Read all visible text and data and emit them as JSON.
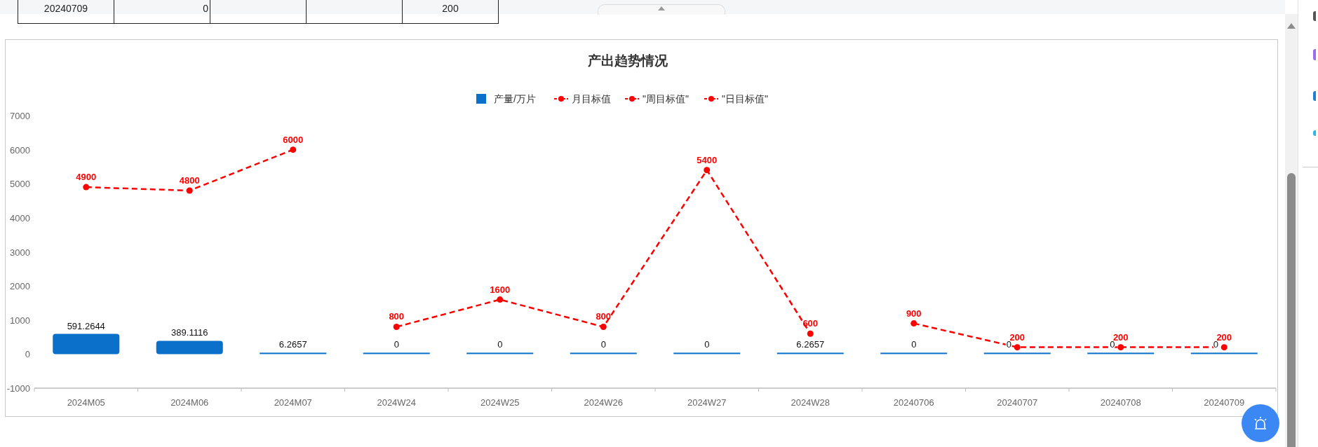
{
  "table_last_row": {
    "column_1": "20240709",
    "column_2": "0",
    "column_5": "200"
  },
  "chart": {
    "title": "产出趋势情况",
    "chart_data": {
      "type": "bar",
      "categories": [
        "2024M05",
        "2024M06",
        "2024M07",
        "2024W24",
        "2024W25",
        "2024W26",
        "2024W27",
        "2024W28",
        "20240706",
        "20240707",
        "20240708",
        "20240709"
      ],
      "ylim": [
        -1000,
        7000
      ],
      "yticks": [
        -1000,
        0,
        1000,
        2000,
        3000,
        4000,
        5000,
        6000,
        7000
      ],
      "data_labels": true,
      "legend": "top",
      "series": [
        {
          "name": "产量/万片",
          "type": "bar",
          "color": "#0a70c9",
          "values": [
            591.2644,
            389.1116,
            6.2657,
            0,
            0,
            0,
            0,
            6.2657,
            0,
            0,
            0,
            0
          ],
          "value_labels": [
            "591.2644",
            "389.1116",
            "6.2657",
            "0",
            "0",
            "0",
            "0",
            "6.2657",
            "0",
            "0",
            "0",
            "0"
          ]
        },
        {
          "name": "月目标值",
          "type": "line",
          "line_style": "dashed",
          "marker": "circle",
          "color": "#ff0000",
          "values": [
            4900,
            4800,
            6000,
            null,
            null,
            null,
            null,
            null,
            null,
            null,
            null,
            null
          ],
          "value_labels": [
            "4900",
            "4800",
            "6000",
            null,
            null,
            null,
            null,
            null,
            null,
            null,
            null,
            null
          ]
        },
        {
          "name": "\"周目标值\"",
          "type": "line",
          "line_style": "dashed",
          "marker": "circle",
          "color": "#ff0000",
          "values": [
            null,
            null,
            null,
            800,
            1600,
            800,
            5400,
            600,
            null,
            null,
            null,
            null
          ],
          "value_labels": [
            null,
            null,
            null,
            "800",
            "1600",
            "800",
            "5400",
            "600",
            null,
            null,
            null,
            null
          ]
        },
        {
          "name": "\"日目标值\"",
          "type": "line",
          "line_style": "dashed",
          "marker": "circle",
          "color": "#ff0000",
          "values": [
            null,
            null,
            null,
            null,
            null,
            null,
            null,
            null,
            900,
            200,
            200,
            200
          ],
          "value_labels": [
            null,
            null,
            null,
            null,
            null,
            null,
            null,
            null,
            "900",
            "200",
            "200",
            "200"
          ]
        }
      ]
    }
  }
}
